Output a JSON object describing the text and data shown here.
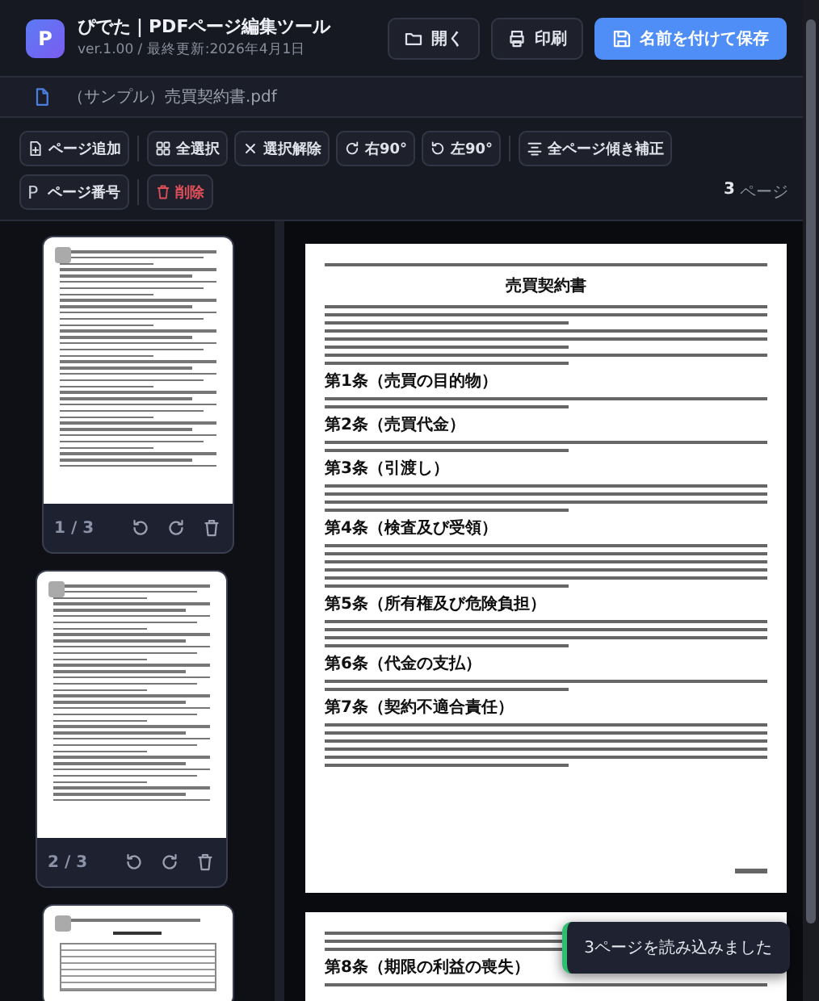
{
  "app": {
    "logo": "P",
    "title": "ぴでた｜PDFページ編集ツール",
    "version": "ver.1.00 / 最終更新:2026年4月1日"
  },
  "header_buttons": [
    {
      "label": "開く",
      "kind": "open",
      "primary": false
    },
    {
      "label": "印刷",
      "kind": "print",
      "primary": false
    },
    {
      "label": "名前を付けて保存",
      "kind": "save",
      "primary": true
    }
  ],
  "file": {
    "name": "（サンプル）売買契約書.pdf"
  },
  "toolbar": {
    "rows": [
      [
        [
          {
            "label": "ページ追加",
            "kind": "add",
            "danger": false
          }
        ],
        [
          {
            "label": "全選択",
            "kind": "select-all",
            "danger": false
          },
          {
            "label": "選択解除",
            "kind": "deselect",
            "danger": false
          },
          {
            "label": "右90°",
            "kind": "rotate-right",
            "danger": false
          },
          {
            "label": "左90°",
            "kind": "rotate-left",
            "danger": false
          }
        ],
        [
          {
            "label": "全ページ傾き補正",
            "kind": "deskew",
            "danger": false
          }
        ]
      ],
      [
        [
          {
            "label": "ページ番号",
            "kind": "numbering",
            "glyph": "P",
            "danger": false
          }
        ],
        [
          {
            "label": "削除",
            "kind": "delete",
            "danger": true
          }
        ]
      ]
    ],
    "page_count": "3",
    "page_count_unit": "ページ"
  },
  "thumbnails": [
    {
      "page_label": "1 / 3",
      "kind": "text"
    },
    {
      "page_label": "2 / 3",
      "kind": "text"
    },
    {
      "kind": "table"
    }
  ],
  "preview_pages": [
    {
      "title": "売買契約書",
      "sections": [
        {
          "heading": "第1条（売買の目的物）"
        },
        {
          "heading": "第2条（売買代金）"
        },
        {
          "heading": "第3条（引渡し）"
        },
        {
          "heading": "第4条（検査及び受領）"
        },
        {
          "heading": "第5条（所有権及び危険負担）"
        },
        {
          "heading": "第6条（代金の支払）"
        },
        {
          "heading": "第7条（契約不適合責任）"
        }
      ]
    },
    {
      "sections": [
        {
          "heading": "第8条（期限の利益の喪失）"
        }
      ]
    }
  ],
  "toast": {
    "message": "3ページを読み込みました"
  }
}
